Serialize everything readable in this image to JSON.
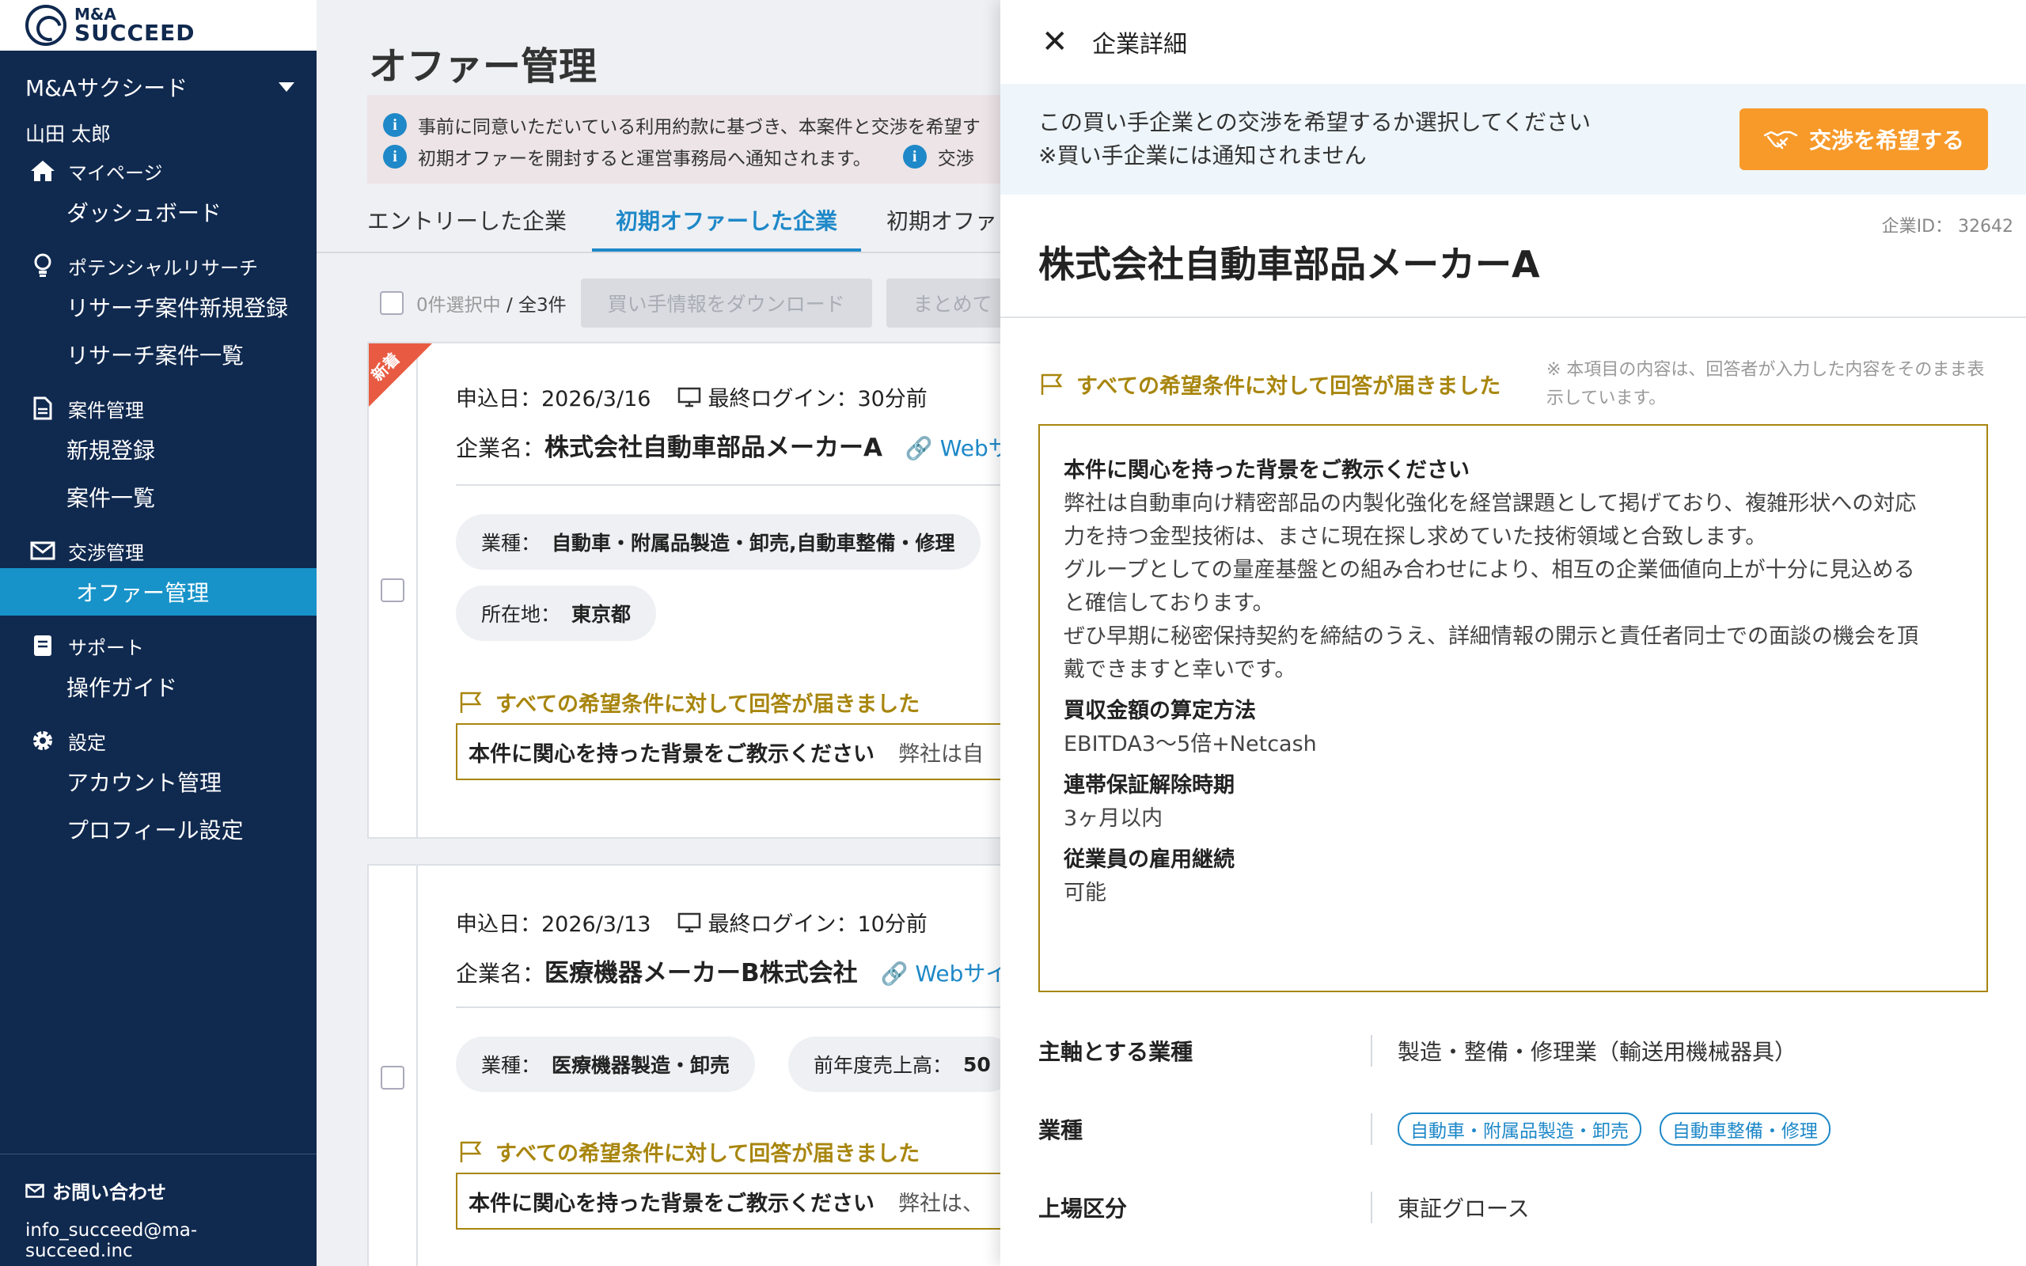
{
  "sidebar": {
    "logo_line1": "M&A",
    "logo_line2": "SUCCEED",
    "org_name": "M&Aサクシード",
    "user_name": "山田 太郎",
    "sections": {
      "mypage": "マイページ",
      "dashboard": "ダッシュボード",
      "potential": "ポテンシャルリサーチ",
      "research_new": "リサーチ案件新規登録",
      "research_list": "リサーチ案件一覧",
      "deals": "案件管理",
      "deal_new": "新規登録",
      "deal_list": "案件一覧",
      "negotiation": "交渉管理",
      "offer": "オファー管理",
      "support": "サポート",
      "guide": "操作ガイド",
      "settings": "設定",
      "account": "アカウント管理",
      "profile": "プロフィール設定"
    },
    "contact_label": "お問い合わせ",
    "contact_email": "info_succeed@ma-succeed.inc"
  },
  "main": {
    "title": "オファー管理",
    "notice1": "事前に同意いただいている利用約款に基づき、本案件と交渉を希望す",
    "notice2": "初期オファーを開封すると運営事務局へ通知されます。",
    "notice3": "交渉",
    "tabs": [
      "エントリーした企業",
      "初期オファーした企業",
      "初期オファ"
    ],
    "selected_text": "0件選択中",
    "total_text": "/ 全3件",
    "btn_download": "買い手情報をダウンロード",
    "btn_bulk": "まとめて",
    "cards": [
      {
        "badge": "新着",
        "apply": "申込日：2026/3/16",
        "login": "最終ログイン：30分前",
        "company_prefix": "企業名：",
        "company": "株式会社自動車部品メーカーA",
        "web": "Webサ",
        "chip1_label": "業種：",
        "chip1_val": "自動車・附属品製造・卸売,自動車整備・修理",
        "chip2_label": "所在地：",
        "chip2_val": "東京都",
        "flag": "すべての希望条件に対して回答が届きました",
        "q": "本件に関心を持った背景をご教示ください",
        "a": "弊社は自"
      },
      {
        "apply": "申込日：2026/3/13",
        "login": "最終ログイン：10分前",
        "company_prefix": "企業名：",
        "company": "医療機器メーカーB株式会社",
        "web": "Webサイ",
        "chip1_label": "業種：",
        "chip1_val": "医療機器製造・卸売",
        "chip2_label": "前年度売上高：",
        "chip2_val": "50",
        "flag": "すべての希望条件に対して回答が届きました",
        "q": "本件に関心を持った背景をご教示ください",
        "a": "弊社は、"
      }
    ]
  },
  "drawer": {
    "title": "企業詳細",
    "band_msg1": "この買い手企業との交渉を希望するか選択してください",
    "band_msg2": "※買い手企業には通知されません",
    "btn_negotiate": "交渉を希望する",
    "company_id": "企業ID： 32642",
    "company_name": "株式会社自動車部品メーカーA",
    "flag": "すべての希望条件に対して回答が届きました",
    "note": "※ 本項目の内容は、回答者が入力した内容をそのまま表示しています。",
    "qa": [
      {
        "q": "本件に関心を持った背景をご教示ください",
        "a": "弊社は自動車向け精密部品の内製化強化を経営課題として掲げており、複雑形状への対応\n力を持つ金型技術は、まさに現在探し求めていた技術領域と合致します。\nグループとしての量産基盤との組み合わせにより、相互の企業価値向上が十分に見込める\nと確信しております。\nぜひ早期に秘密保持契約を締結のうえ、詳細情報の開示と責任者同士での面談の機会を頂\n戴できますと幸いです。"
      },
      {
        "q": "買収金額の算定方法",
        "a": "EBITDA3〜5倍+Netcash"
      },
      {
        "q": "連帯保証解除時期",
        "a": "3ヶ月以内"
      },
      {
        "q": "従業員の雇用継続",
        "a": "可能"
      }
    ],
    "props": {
      "main_industry_label": "主軸とする業種",
      "main_industry_val": "製造・整備・修理業（輸送用機械器具）",
      "industry_label": "業種",
      "industry_tags": [
        "自動車・附属品製造・卸売",
        "自動車整備・修理"
      ],
      "listing_label": "上場区分",
      "listing_val": "東証グロース"
    }
  },
  "colors": {
    "navy": "#10294f",
    "accent": "#1e88c8",
    "orange": "#f79a2a",
    "gold": "#a8860e",
    "ribbon": "#e85b42"
  }
}
